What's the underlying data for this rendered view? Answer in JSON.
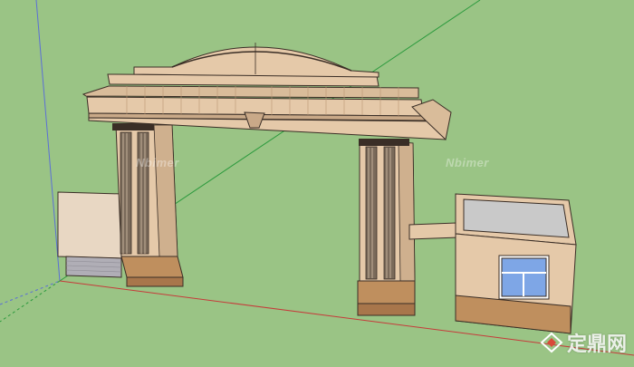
{
  "scene": {
    "description_free": true,
    "colors": {
      "ground": "#9ac485",
      "stone": "#e5c9a9",
      "stone_shade": "#cfb08e",
      "stone_dark": "#b89574",
      "base": "#bf8f5e",
      "outline": "#3a2e26",
      "axis_red": "#c63a3a",
      "axis_green": "#2b9a3d",
      "axis_blue": "#5b6fd6",
      "window_glass": "#7ea6e6",
      "roof_gray": "#c9c9c9",
      "wall_texture": "#e8d7c3",
      "brick_gray": "#b0aeb6"
    }
  },
  "watermarks": {
    "left": "Nbimer",
    "right": "Nbimer"
  },
  "brand": {
    "logo_icon": "diamond-logo-icon",
    "text": "定鼎网"
  }
}
